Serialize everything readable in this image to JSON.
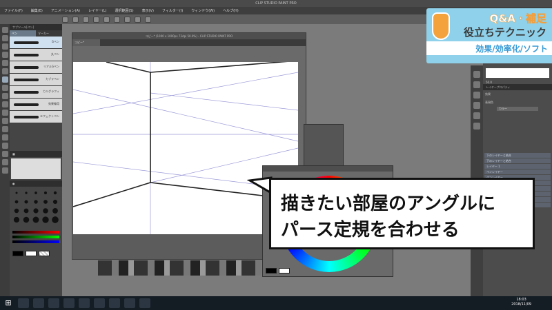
{
  "window": {
    "title": "CLIP STUDIO PAINT PRO",
    "canvas_title": "コピー* (1000 x 1000px 72dpi 50.0%) - CLIP STUDIO PAINT PRO",
    "canvas_tab": "コピー*"
  },
  "menu": [
    "ファイル(F)",
    "編集(E)",
    "アニメーション(A)",
    "レイヤー(L)",
    "選択範囲(S)",
    "表示(V)",
    "フィルター(I)",
    "ウィンドウ(W)",
    "ヘルプ(H)"
  ],
  "subtool": {
    "header": "サブツール[ペン]",
    "tabs": [
      "ペン",
      "マーカー"
    ],
    "brushes": [
      "Gペン",
      "丸ペン",
      "リアルGペン",
      "カブラペン",
      "カリグラフィ",
      "効果線用",
      "エフェクトペン"
    ]
  },
  "brush_sizes": [
    "0.7",
    "1",
    "1.5",
    "2",
    "2.5",
    "3",
    "4",
    "5",
    "6",
    "7",
    "8",
    "10",
    "12",
    "15",
    "17",
    "20",
    "25",
    "30",
    "40",
    "50"
  ],
  "right_panel": {
    "navigator_zoom": "50.0",
    "layer_header": "レイヤープロパティ",
    "effect_label": "効果",
    "color_label": "表現色",
    "color_value": "カラー",
    "layer_rows": [
      "下のレイヤーと結合",
      "下のレイヤーと結合",
      "レイヤー 1",
      "ペンレイヤー",
      "ペンレイヤー",
      "ペンレイヤー",
      "ペンレイヤー",
      "ペンレイヤー",
      "ペンレイヤー",
      "ペンレイヤー"
    ]
  },
  "badge": {
    "line1": "Q&A・補足",
    "line2": "役立ちテクニック",
    "line3": "効果/効率化/ソフト"
  },
  "callout": {
    "line1": "描きたい部屋のアングルに",
    "line2": "パース定規を合わせる"
  },
  "taskbar": {
    "time": "18:03",
    "date": "2018/11/09"
  },
  "colors": {
    "badge_bg": "#8fd1ea",
    "badge_accent": "#3a9bd6",
    "callout_border": "#111111"
  }
}
